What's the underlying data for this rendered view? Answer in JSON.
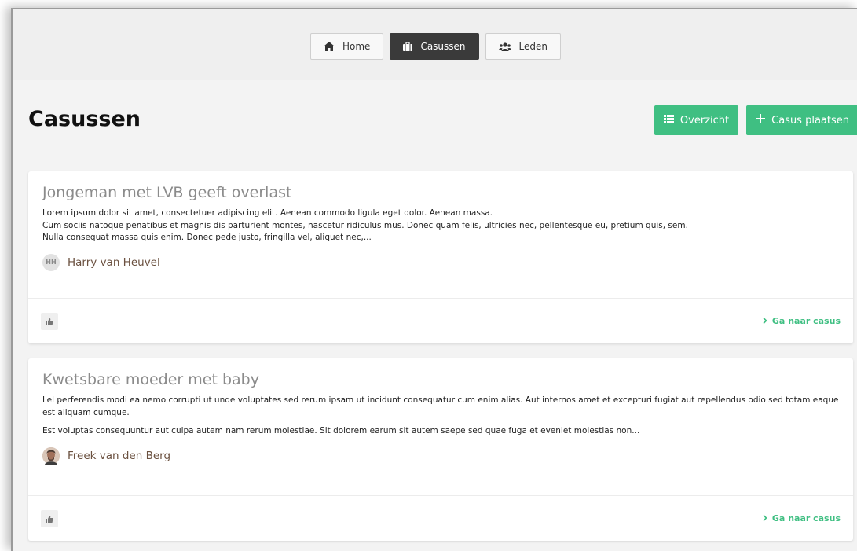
{
  "colors": {
    "accent": "#3fbf82",
    "nav_active": "#3a3a3a",
    "author": "#6b5140"
  },
  "nav": {
    "items": [
      {
        "label": "Home",
        "icon": "home-icon",
        "active": false
      },
      {
        "label": "Casussen",
        "icon": "briefcase-icon",
        "active": true
      },
      {
        "label": "Leden",
        "icon": "users-icon",
        "active": false
      }
    ]
  },
  "page": {
    "title": "Casussen",
    "overview_label": "Overzicht",
    "add_label": "Casus plaatsen"
  },
  "cases": [
    {
      "title": "Jongeman met LVB geeft overlast",
      "paragraphs": [
        "Lorem ipsum dolor sit amet, consectetuer adipiscing elit. Aenean commodo ligula eget dolor. Aenean massa.\nCum sociis natoque penatibus et magnis dis parturient montes, nascetur ridiculus mus. Donec quam felis, ultricies nec, pellentesque eu, pretium quis, sem.\nNulla consequat massa quis enim. Donec pede justo, fringilla vel, aliquet nec,..."
      ],
      "author_initials": "HH",
      "author_name": "Harry van Heuvel",
      "link_label": "Ga naar casus"
    },
    {
      "title": "Kwetsbare moeder met baby",
      "paragraphs": [
        "Lel perferendis modi ea nemo corrupti ut unde voluptates sed rerum ipsam ut incidunt consequatur cum enim alias. Aut internos amet et excepturi fugiat aut repellendus odio sed totam eaque est aliquam cumque.",
        "Est voluptas consequuntur aut culpa autem nam rerum molestiae. Sit dolorem earum sit autem saepe sed quae fuga et eveniet molestias non..."
      ],
      "author_name": "Freek van den Berg",
      "link_label": "Ga naar casus"
    }
  ]
}
